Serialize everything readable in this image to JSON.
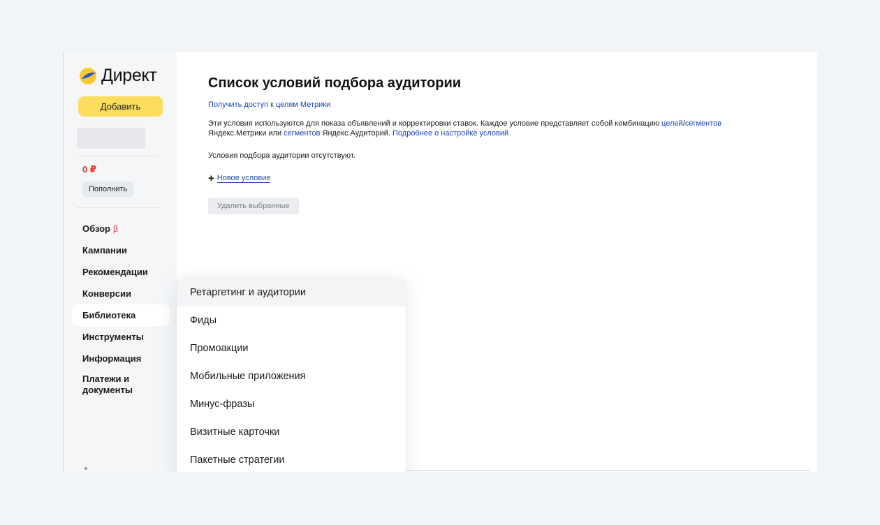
{
  "sidebar": {
    "logo_text": "Директ",
    "add_button": "Добавить",
    "balance": "0 ₽",
    "topup_button": "Пополнить",
    "beta_mark": "β",
    "nav": [
      {
        "label": "Обзор"
      },
      {
        "label": "Кампании"
      },
      {
        "label": "Рекомендации"
      },
      {
        "label": "Конверсии"
      },
      {
        "label": "Библиотека",
        "active": true
      },
      {
        "label": "Инструменты"
      },
      {
        "label": "Информация"
      },
      {
        "label": "Платежи и документы"
      }
    ]
  },
  "main": {
    "title": "Список условий подбора аудитории",
    "metrics_link": "Получить доступ к целям Метрики",
    "desc": {
      "part1": "Эти условия используются для показа объявлений и корректировки ставок. Каждое условие представляет собой комбинацию ",
      "link_goals": "целей",
      "slash": "/",
      "link_segments1": "сегментов",
      "part2": " Яндекс.Метрики или ",
      "link_segments2": "сегментов",
      "part3": " Яндекс.Аудиторий. ",
      "link_more": "Подробнее о настройке условий"
    },
    "empty_text": "Условия подбора аудитории отсутствуют.",
    "new_condition": "Новое условие",
    "delete_button": "Удалить выбранные"
  },
  "dropdown": {
    "items": [
      "Ретаргетинг и аудитории",
      "Фиды",
      "Промоакции",
      "Мобильные приложения",
      "Минус-фразы",
      "Визитные карточки",
      "Пакетные стратегии"
    ]
  },
  "colors": {
    "accent_yellow": "#fcdc5c",
    "link_blue": "#1c45b8",
    "balance_red": "#e8322f",
    "background": "#f2f5f8"
  }
}
